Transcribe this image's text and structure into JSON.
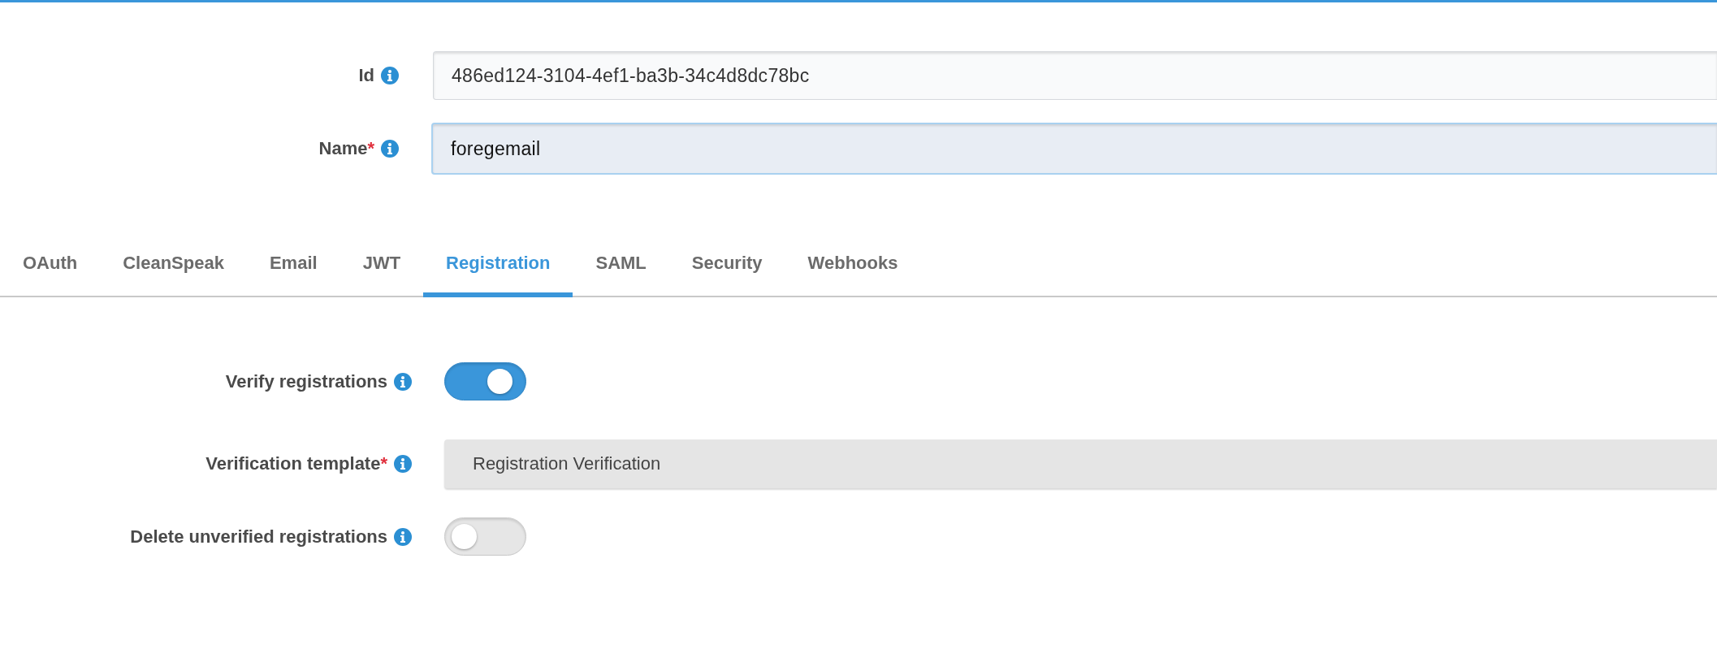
{
  "header_fields": [
    {
      "label": "Id",
      "value": "486ed124-3104-4ef1-ba3b-34c4d8dc78bc",
      "focused": false
    },
    {
      "label": "Name",
      "required_mark": "*",
      "value": "foregemail",
      "focused": true
    }
  ],
  "tabs": [
    {
      "label": "OAuth",
      "selected": false
    },
    {
      "label": "CleanSpeak",
      "selected": false
    },
    {
      "label": "Email",
      "selected": false
    },
    {
      "label": "JWT",
      "selected": false
    },
    {
      "label": "Registration",
      "selected": true
    },
    {
      "label": "SAML",
      "selected": false
    },
    {
      "label": "Security",
      "selected": false
    },
    {
      "label": "Webhooks",
      "selected": false
    }
  ],
  "registration_settings": [
    {
      "kind": "toggle",
      "label": "Verify registrations",
      "on": true
    },
    {
      "kind": "select",
      "label": "Verification template",
      "required_mark": "*",
      "value": "Registration Verification"
    },
    {
      "kind": "toggle",
      "label": "Delete unverified registrations",
      "on": false
    }
  ]
}
